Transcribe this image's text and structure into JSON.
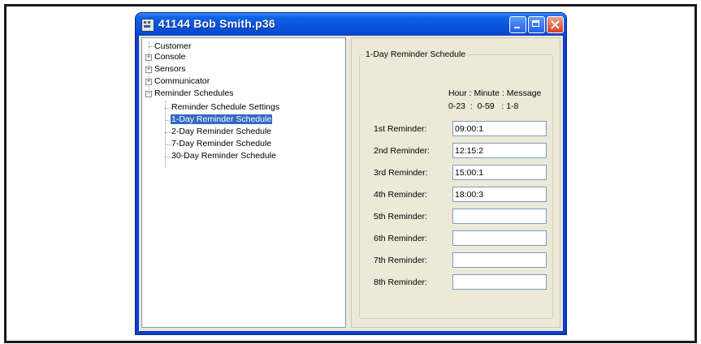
{
  "window": {
    "title": "41144 Bob Smith.p36",
    "controls": [
      "minimize-icon",
      "maximize-icon",
      "close-icon"
    ]
  },
  "tree": {
    "items": [
      {
        "label": "Customer",
        "expander": "none"
      },
      {
        "label": "Console",
        "expander": "+"
      },
      {
        "label": "Sensors",
        "expander": "+"
      },
      {
        "label": "Communicator",
        "expander": "+"
      },
      {
        "label": "Reminder Schedules",
        "expander": "-"
      },
      {
        "label": "Reminder Schedule Settings",
        "expander": "none"
      },
      {
        "label": "1-Day Reminder Schedule",
        "expander": "none",
        "selected": true
      },
      {
        "label": "2-Day Reminder Schedule",
        "expander": "none"
      },
      {
        "label": "7-Day Reminder Schedule",
        "expander": "none"
      },
      {
        "label": "30-Day Reminder Schedule",
        "expander": "none"
      }
    ]
  },
  "panel": {
    "group_title": "1-Day Reminder Schedule",
    "header_line1": "Hour : Minute : Message",
    "header_line2": "0-23  :  0-59   : 1-8",
    "reminders": [
      {
        "label": "1st Reminder:",
        "value": "09:00:1"
      },
      {
        "label": "2nd Reminder:",
        "value": "12:15:2"
      },
      {
        "label": "3rd Reminder:",
        "value": "15:00:1"
      },
      {
        "label": "4th Reminder:",
        "value": "18:00:3"
      },
      {
        "label": "5th Reminder:",
        "value": ""
      },
      {
        "label": "6th Reminder:",
        "value": ""
      },
      {
        "label": "7th Reminder:",
        "value": ""
      },
      {
        "label": "8th Reminder:",
        "value": ""
      }
    ]
  },
  "colors": {
    "titlebar": "#0a55dc",
    "selection": "#316ac5",
    "window_bg": "#ece9d8",
    "close_button": "#d9401f"
  }
}
